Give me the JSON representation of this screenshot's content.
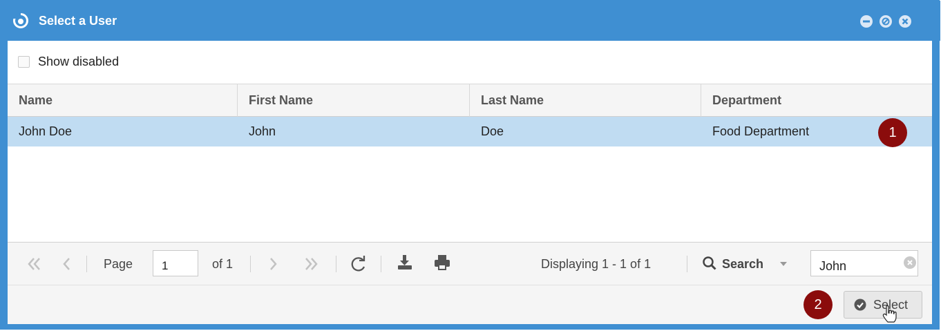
{
  "window": {
    "title": "Select a User",
    "logo_icon": "circle-logo-icon",
    "controls": [
      "minimize-icon",
      "restore-icon",
      "close-icon"
    ]
  },
  "filter": {
    "show_disabled_label": "Show disabled",
    "show_disabled_checked": false
  },
  "grid": {
    "columns": [
      "Name",
      "First Name",
      "Last Name",
      "Department"
    ],
    "rows": [
      {
        "name": "John Doe",
        "first_name": "John",
        "last_name": "Doe",
        "department": "Food Department",
        "selected": true
      }
    ]
  },
  "pager": {
    "page_label": "Page",
    "page_value": "1",
    "of_label": "of 1",
    "displaying": "Displaying 1 - 1 of 1",
    "search_label": "Search",
    "search_value": "John"
  },
  "footer": {
    "select_label": "Select"
  },
  "annotations": {
    "badge1": "1",
    "badge2": "2",
    "badge_color": "#8b0c0c"
  },
  "colors": {
    "titlebar": "#3f8fd2",
    "selected_row": "#c0dcf2"
  }
}
